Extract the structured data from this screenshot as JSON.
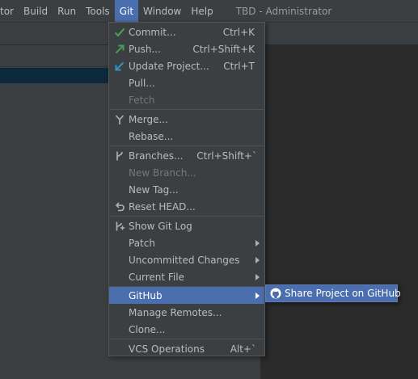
{
  "menubar": {
    "items": [
      "tor",
      "Build",
      "Run",
      "Tools",
      "Git",
      "Window",
      "Help"
    ],
    "active_index": 4,
    "title": "TBD - Administrator"
  },
  "git_menu": {
    "items": [
      {
        "label": "Commit...",
        "shortcut": "Ctrl+K",
        "icon": "check-icon"
      },
      {
        "label": "Push...",
        "shortcut": "Ctrl+Shift+K",
        "icon": "push-arrow-icon"
      },
      {
        "label": "Update Project...",
        "shortcut": "Ctrl+T",
        "icon": "update-arrow-icon"
      },
      {
        "label": "Pull..."
      },
      {
        "label": "Fetch",
        "disabled": true
      },
      {
        "label": "Merge...",
        "icon": "merge-icon"
      },
      {
        "label": "Rebase..."
      },
      {
        "label": "Branches...",
        "shortcut": "Ctrl+Shift+`",
        "icon": "branch-icon"
      },
      {
        "label": "New Branch...",
        "disabled": true
      },
      {
        "label": "New Tag..."
      },
      {
        "label": "Reset HEAD...",
        "icon": "reset-icon"
      },
      {
        "label": "Show Git Log",
        "icon": "git-log-icon"
      },
      {
        "label": "Patch",
        "submenu": true
      },
      {
        "label": "Uncommitted Changes",
        "submenu": true
      },
      {
        "label": "Current File",
        "submenu": true
      },
      {
        "label": "GitHub",
        "submenu": true,
        "highlighted": true
      },
      {
        "label": "Manage Remotes..."
      },
      {
        "label": "Clone..."
      },
      {
        "label": "VCS Operations",
        "shortcut": "Alt+`"
      }
    ]
  },
  "github_submenu": {
    "label": "Share Project on GitHub",
    "icon": "github-icon"
  }
}
